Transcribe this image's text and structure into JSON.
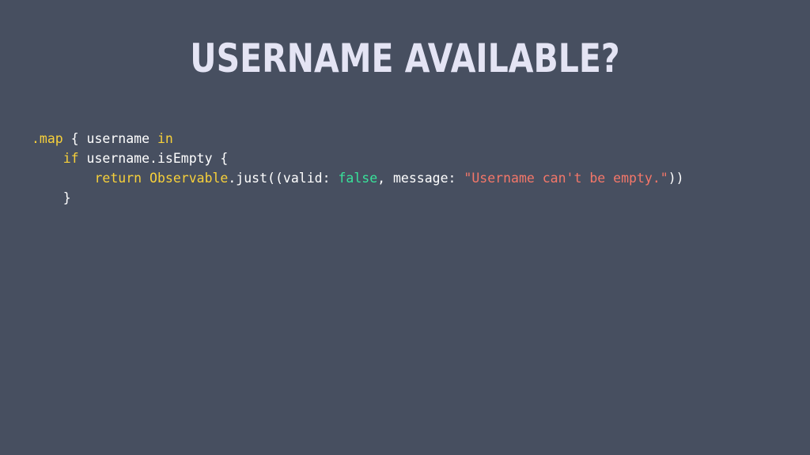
{
  "slide": {
    "title": "USERNAME AVAILABLE?",
    "code_lines": [
      [
        {
          "text": ".map",
          "kind": "yellow"
        },
        {
          "text": " { username ",
          "kind": "white"
        },
        {
          "text": "in",
          "kind": "yellow"
        }
      ],
      [
        {
          "text": "    ",
          "kind": "white"
        },
        {
          "text": "if",
          "kind": "yellow"
        },
        {
          "text": " username.isEmpty {",
          "kind": "white"
        }
      ],
      [
        {
          "text": "        ",
          "kind": "white"
        },
        {
          "text": "return",
          "kind": "yellow"
        },
        {
          "text": " ",
          "kind": "white"
        },
        {
          "text": "Observable",
          "kind": "yellow"
        },
        {
          "text": ".just((valid: ",
          "kind": "white"
        },
        {
          "text": "false",
          "kind": "green"
        },
        {
          "text": ", message: ",
          "kind": "white"
        },
        {
          "text": "\"Username can't be empty.\"",
          "kind": "red"
        },
        {
          "text": "))",
          "kind": "white"
        }
      ],
      [
        {
          "text": "    }",
          "kind": "white"
        }
      ]
    ]
  },
  "colors": {
    "background": "#474f60",
    "title": "#e4e4f4",
    "keyword": "#f7d03a",
    "boolean": "#38e29a",
    "string": "#f47769",
    "text": "#ffffff"
  }
}
